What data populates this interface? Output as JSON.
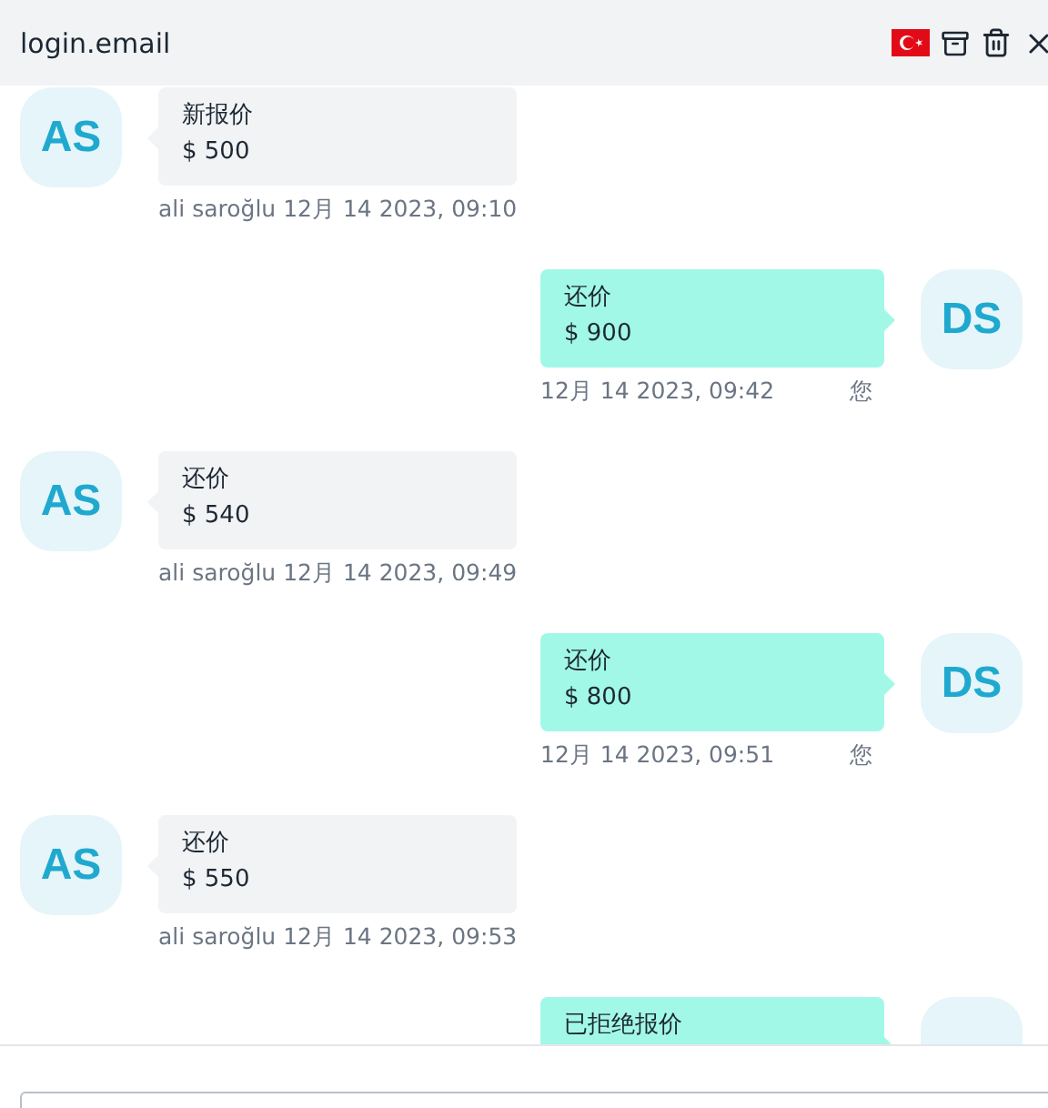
{
  "header": {
    "title": "login.email"
  },
  "messages": [
    {
      "kind": "received",
      "avatar": "AS",
      "title": "新报价",
      "amount": "$ 500",
      "sender": "ali saroğlu",
      "time": "12月 14 2023, 09:10"
    },
    {
      "kind": "sent",
      "avatar": "DS",
      "title": "还价",
      "amount": "$ 900",
      "time": "12月 14 2023, 09:42",
      "you": "您"
    },
    {
      "kind": "received",
      "avatar": "AS",
      "title": "还价",
      "amount": "$ 540",
      "sender": "ali saroğlu",
      "time": "12月 14 2023, 09:49"
    },
    {
      "kind": "sent",
      "avatar": "DS",
      "title": "还价",
      "amount": "$ 800",
      "time": "12月 14 2023, 09:51",
      "you": "您"
    },
    {
      "kind": "received",
      "avatar": "AS",
      "title": "还价",
      "amount": "$ 550",
      "sender": "ali saroğlu",
      "time": "12月 14 2023, 09:53"
    },
    {
      "kind": "sent",
      "title": "已拒绝报价"
    }
  ]
}
